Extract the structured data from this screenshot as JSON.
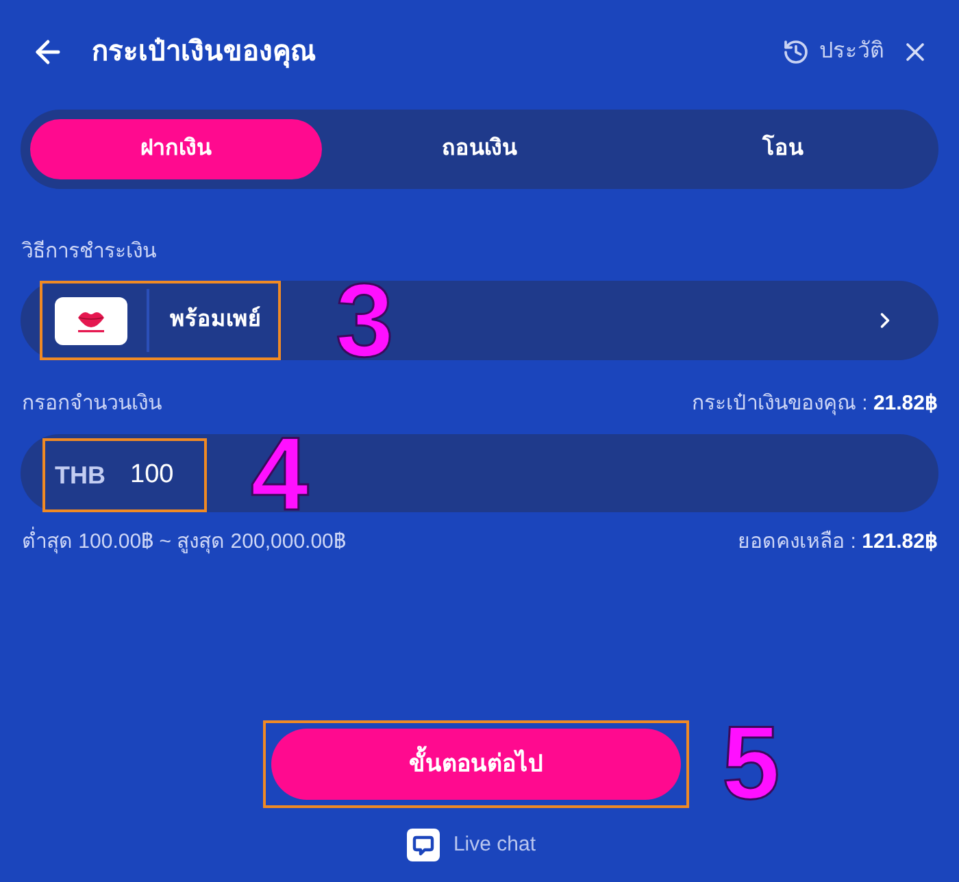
{
  "header": {
    "title": "กระเป๋าเงินของคุณ",
    "history_label": "ประวัติ"
  },
  "tabs": [
    {
      "label": "ฝากเงิน",
      "selected": true
    },
    {
      "label": "ถอนเงิน",
      "selected": false
    },
    {
      "label": "โอน",
      "selected": false
    }
  ],
  "payment_method": {
    "label": "วิธีการชำระเงิน",
    "name": "พร้อมเพย์",
    "callout": "3"
  },
  "amount": {
    "label": "กรอกจำนวนเงิน",
    "wallet_balance": "กระเป๋าเงินของคุณ : **21.82฿**",
    "currency": "THB",
    "value": "100",
    "callout": "4",
    "limits": "ต่ำสุด 100.00฿ ~ สูงสุด 200,000.00฿",
    "remaining": "ยอดคงเหลือ : **121.82฿**"
  },
  "next_button": {
    "label": "ขั้นตอนต่อไป",
    "callout": "5"
  },
  "live_chat": {
    "label": "Live chat"
  }
}
